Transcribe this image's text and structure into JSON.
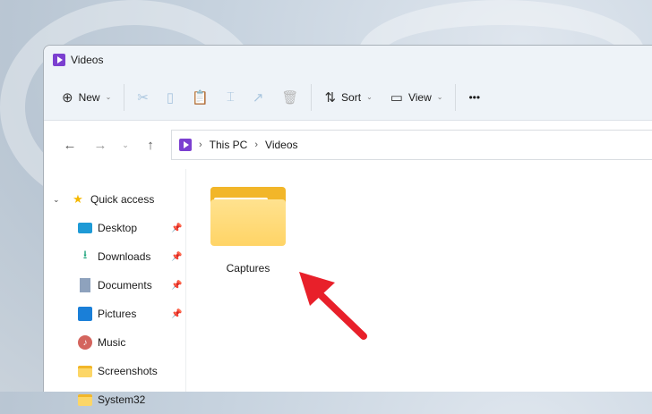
{
  "window": {
    "title": "Videos"
  },
  "toolbar": {
    "new_label": "New",
    "sort_label": "Sort",
    "view_label": "View",
    "more_label": "•••"
  },
  "address": {
    "crumbs": [
      "This PC",
      "Videos"
    ]
  },
  "sidebar": {
    "quick_access": "Quick access",
    "items": [
      {
        "label": "Desktop",
        "icon": "desktop-icon",
        "pinned": true
      },
      {
        "label": "Downloads",
        "icon": "download-icon",
        "pinned": true
      },
      {
        "label": "Documents",
        "icon": "document-icon",
        "pinned": true
      },
      {
        "label": "Pictures",
        "icon": "pictures-icon",
        "pinned": true
      },
      {
        "label": "Music",
        "icon": "music-icon",
        "pinned": false
      },
      {
        "label": "Screenshots",
        "icon": "folder-icon",
        "pinned": false
      },
      {
        "label": "System32",
        "icon": "folder-icon",
        "pinned": false
      }
    ]
  },
  "content": {
    "items": [
      {
        "name": "Captures",
        "type": "folder"
      }
    ]
  },
  "annotation": {
    "arrow_color": "#e8202a"
  }
}
